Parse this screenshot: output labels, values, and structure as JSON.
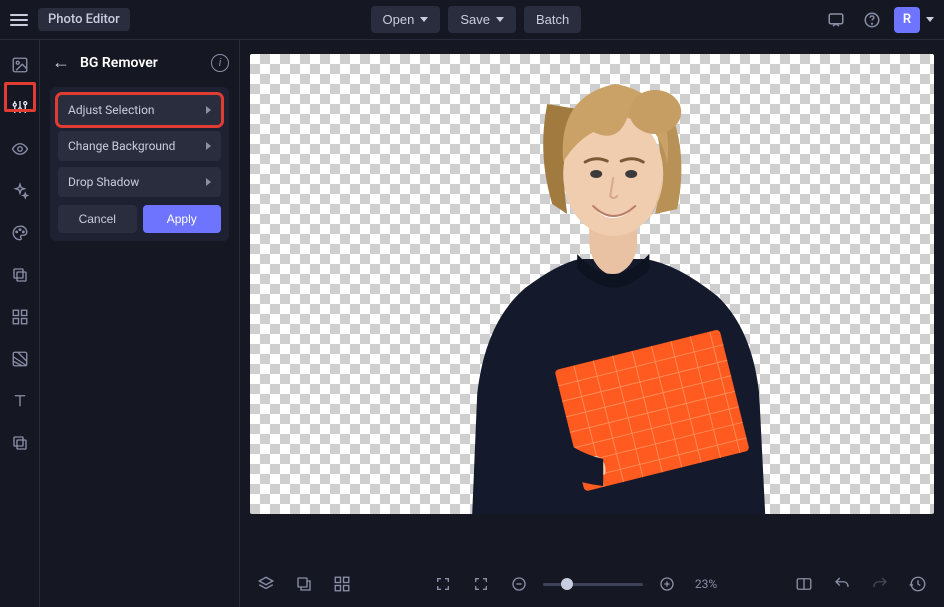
{
  "app": {
    "title": "Photo Editor"
  },
  "topbar": {
    "open": "Open",
    "save": "Save",
    "batch": "Batch",
    "avatar_letter": "R"
  },
  "rail": {
    "items": [
      {
        "name": "image-icon"
      },
      {
        "name": "adjust-icon",
        "active": true
      },
      {
        "name": "eye-icon"
      },
      {
        "name": "sparkle-icon"
      },
      {
        "name": "palette-icon"
      },
      {
        "name": "layers-square-icon"
      },
      {
        "name": "grid-icon"
      },
      {
        "name": "overlay-icon"
      },
      {
        "name": "text-icon"
      },
      {
        "name": "copy-icon"
      }
    ]
  },
  "panel": {
    "title": "BG Remover",
    "options": {
      "adjust_selection": "Adjust Selection",
      "change_background": "Change Background",
      "drop_shadow": "Drop Shadow"
    },
    "cancel": "Cancel",
    "apply": "Apply"
  },
  "bottombar": {
    "zoom_label": "23%"
  },
  "colors": {
    "accent": "#6f74ff",
    "highlight": "#e03c31",
    "bg": "#151722"
  }
}
